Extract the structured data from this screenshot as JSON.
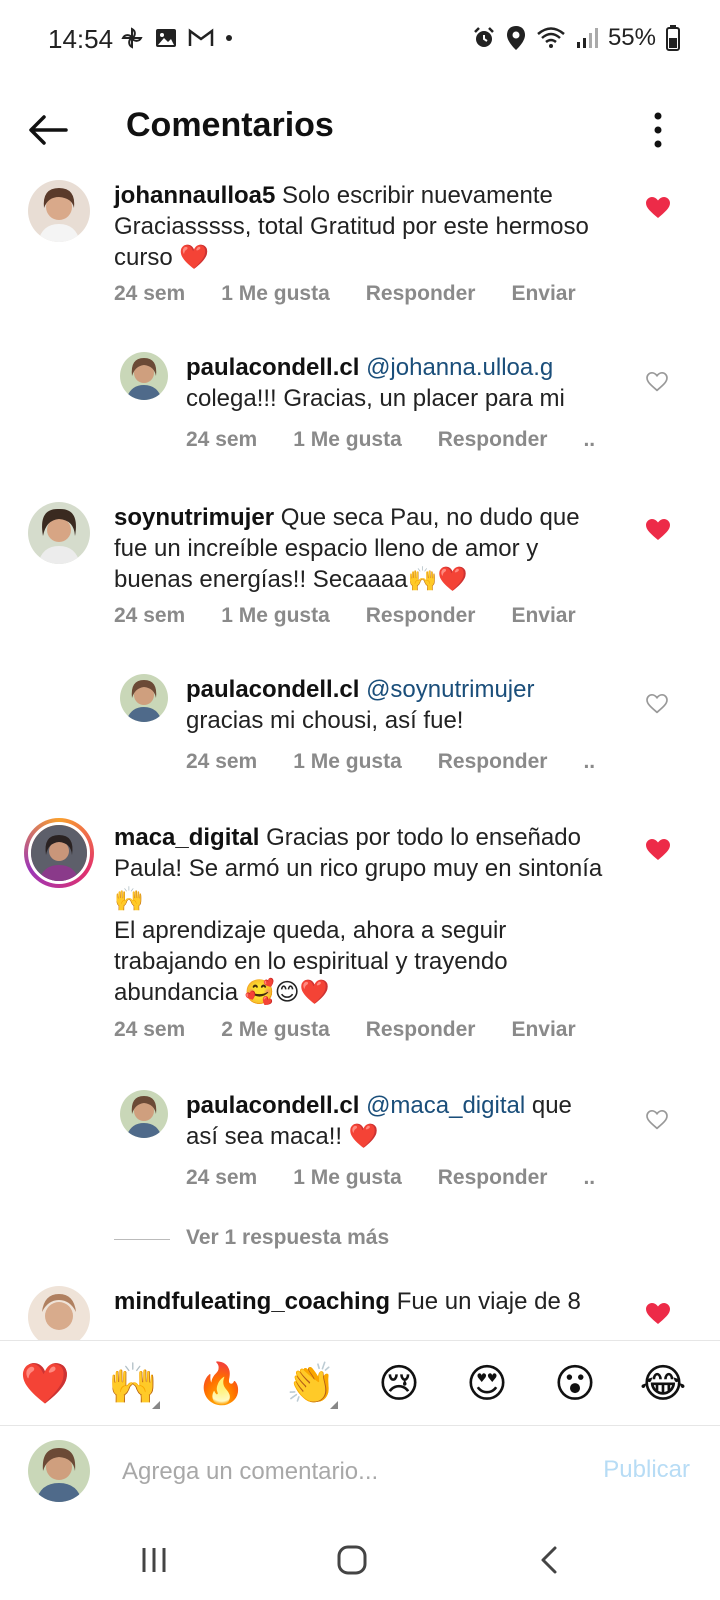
{
  "status_bar": {
    "time": "14:54",
    "battery": "55%",
    "left_icons": [
      "pinwheel-icon",
      "image-icon",
      "gmail-icon",
      "dot-icon"
    ],
    "right_icons": [
      "alarm-icon",
      "location-icon",
      "wifi-icon",
      "signal-icon",
      "battery-icon"
    ]
  },
  "header": {
    "title": "Comentarios",
    "back_icon": "back-arrow-icon",
    "menu_icon": "more-vert-icon"
  },
  "comments": [
    {
      "username": "johannaulloa5",
      "text": "Solo escribir nuevamente Graciasssss, total Gratitud por este hermoso curso",
      "emoji": "❤️",
      "time": "24 sem",
      "likes": "1 Me gusta",
      "reply": "Responder",
      "send": "Enviar",
      "liked": true
    },
    {
      "username": "paulacondell.cl",
      "mention": "@johanna.ulloa.g",
      "text": "colega!!! Gracias, un placer para mi",
      "time": "24 sem",
      "likes": "1 Me gusta",
      "reply": "Responder",
      "more": "..",
      "liked": false
    },
    {
      "username": "soynutrimujer",
      "text": "Que seca Pau, no dudo que fue un increíble espacio lleno de amor y buenas energías!! Secaaaa",
      "emoji": "🙌❤️",
      "time": "24 sem",
      "likes": "1 Me gusta",
      "reply": "Responder",
      "send": "Enviar",
      "liked": true
    },
    {
      "username": "paulacondell.cl",
      "mention": "@soynutrimujer",
      "text": "gracias mi chousi, así fue!",
      "time": "24 sem",
      "likes": "1 Me gusta",
      "reply": "Responder",
      "more": "..",
      "liked": false
    },
    {
      "username": "maca_digital",
      "text_1": "Gracias por todo lo enseñado Paula! Se armó un rico grupo muy en sintonía",
      "emoji_1": "🙌",
      "text_2": "El aprendizaje queda, ahora a seguir trabajando en lo espiritual y trayendo abundancia",
      "emoji_2": "🥰😊❤️",
      "time": "24 sem",
      "likes": "2 Me gusta",
      "reply": "Responder",
      "send": "Enviar",
      "liked": true
    },
    {
      "username": "paulacondell.cl",
      "mention": "@maca_digital",
      "text": "que así sea maca!!",
      "emoji": "❤️",
      "time": "24 sem",
      "likes": "1 Me gusta",
      "reply": "Responder",
      "more": "..",
      "liked": false
    },
    {
      "username": "mindfuleating_coaching",
      "text": "Fue un viaje de 8"
    }
  ],
  "more_replies": "Ver 1 respuesta más",
  "emoji_bar": [
    {
      "emoji": "❤️",
      "name": "red-heart"
    },
    {
      "emoji": "🙌",
      "name": "raising-hands"
    },
    {
      "emoji": "🔥",
      "name": "fire"
    },
    {
      "emoji": "👏",
      "name": "clapping-hands"
    },
    {
      "emoji": "😢",
      "name": "crying-face"
    },
    {
      "emoji": "😍",
      "name": "heart-eyes"
    },
    {
      "emoji": "😮",
      "name": "surprised-face"
    },
    {
      "emoji": "😂",
      "name": "tears-of-joy"
    }
  ],
  "composer": {
    "placeholder": "Agrega un comentario...",
    "publish": "Publicar"
  },
  "colors": {
    "liked_heart": "#ed2b48",
    "mention": "#1a4e7a",
    "meta_gray": "#8a8a8a",
    "publish_disabled": "#b7dcf5"
  }
}
